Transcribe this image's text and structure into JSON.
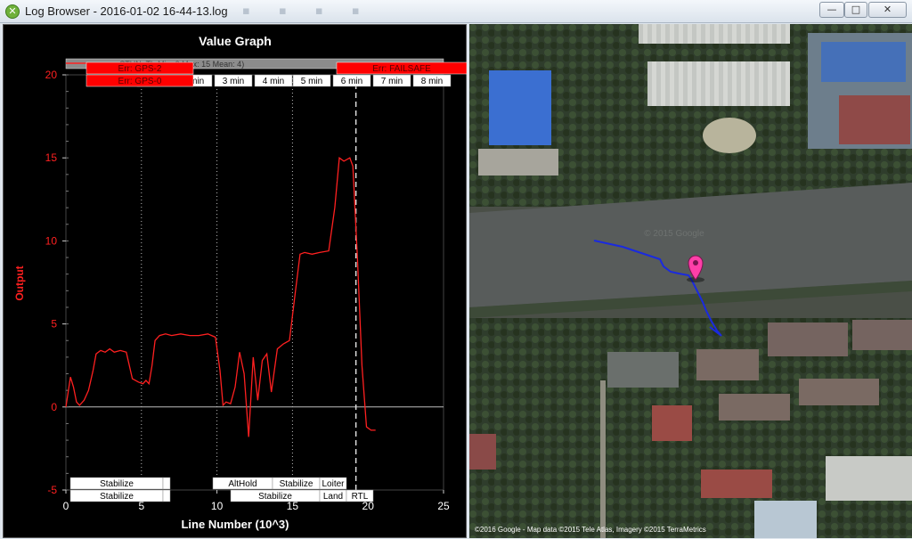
{
  "window": {
    "title": "Log Browser - 2016-01-02 16-44-13.log",
    "min_glyph": "—",
    "max_glyph": "□",
    "close_glyph": "✕",
    "app_icon": "ardupilot-x-icon"
  },
  "graph": {
    "title": "Value Graph",
    "xlabel": "Line Number (10^3)",
    "ylabel": "Output",
    "stats_label": "CTUN: ThrMin: 0 Max: 15 Mean: 4)",
    "errors": [
      "Err: GPS-2",
      "Err: GPS-0",
      "Err: FAILSAFE"
    ],
    "time_marks": [
      "1 min",
      "2 min",
      "3 min",
      "4 min",
      "5 min",
      "6 min",
      "7 min",
      "8 min"
    ],
    "modes_row1": [
      "Stabilize",
      "",
      "AltHold",
      "Stabilize",
      "Loiter"
    ],
    "modes_row2": [
      "Stabilize",
      "",
      "Stabilize",
      "Land",
      "RTL"
    ]
  },
  "chart_data": {
    "type": "line",
    "title": "Value Graph",
    "xlabel": "Line Number (10^3)",
    "ylabel": "Output",
    "xlim": [
      0,
      25
    ],
    "ylim": [
      -5,
      20
    ],
    "xticks": [
      "0",
      "5",
      "10",
      "15",
      "20",
      "25"
    ],
    "yticks": [
      "-5",
      "0",
      "5",
      "10",
      "15",
      "20"
    ],
    "series": [
      {
        "color": "#ff2020",
        "x": [
          0.0,
          0.3,
          0.5,
          0.7,
          0.9,
          1.2,
          1.5,
          1.8,
          2.0,
          2.3,
          2.6,
          2.9,
          3.2,
          3.6,
          4.0,
          4.4,
          4.8,
          5.1,
          5.3,
          5.5,
          5.7,
          5.9,
          6.2,
          6.6,
          7.0,
          7.6,
          8.2,
          8.8,
          9.4,
          9.9,
          10.2,
          10.4,
          10.6,
          10.9,
          11.2,
          11.5,
          11.8,
          12.1,
          12.4,
          12.7,
          13.0,
          13.3,
          13.6,
          14.0,
          14.4,
          14.8,
          15.2,
          15.5,
          15.8,
          16.3,
          16.8,
          17.4,
          17.8,
          18.1,
          18.4,
          18.8,
          19.0,
          19.3,
          19.6,
          19.9,
          20.2,
          20.5
        ],
        "y": [
          0.0,
          1.8,
          1.2,
          0.3,
          0.1,
          0.4,
          1.0,
          2.2,
          3.2,
          3.4,
          3.3,
          3.5,
          3.3,
          3.4,
          3.3,
          1.7,
          1.5,
          1.4,
          1.6,
          1.4,
          2.5,
          4.0,
          4.3,
          4.4,
          4.3,
          4.4,
          4.3,
          4.3,
          4.4,
          4.2,
          2.2,
          0.1,
          0.3,
          0.2,
          1.2,
          3.3,
          2.0,
          -1.8,
          3.0,
          0.4,
          2.8,
          3.2,
          0.9,
          3.5,
          3.8,
          4.0,
          7.0,
          9.2,
          9.3,
          9.2,
          9.3,
          9.4,
          12.0,
          15.0,
          14.8,
          15.0,
          14.5,
          9.0,
          2.5,
          -1.2,
          -1.4,
          -1.4
        ]
      }
    ],
    "grid": true,
    "mode_changes_x": [
      5.0,
      10.0,
      15.0,
      19.2
    ],
    "dashed_marker_x": 19.2
  },
  "map": {
    "copyright": "©2016 Google - Map data ©2015 Tele Atlas, Imagery ©2015 TerraMetrics",
    "watermark": "© 2015 Google",
    "pin_color": "#ff3fa8",
    "track_color": "#1a2adf"
  }
}
